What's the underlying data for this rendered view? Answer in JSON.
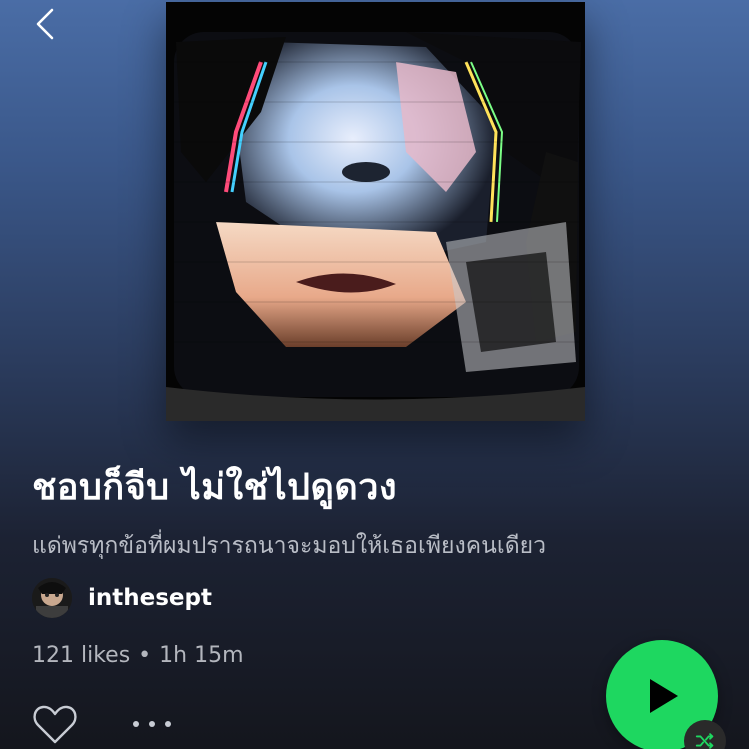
{
  "nav": {
    "back_icon": "chevron-left-icon"
  },
  "playlist": {
    "title": "ชอบก็จีบ ไม่ใช่ไปดูดวง",
    "description": "แด่พรทุกข้อที่ผมปรารถนาจะมอบให้เธอเพียงคนเดียว",
    "owner": "inthesept",
    "likes": "121 likes",
    "separator": "•",
    "duration": "1h 15m"
  },
  "actions": {
    "like_icon": "heart-outline-icon",
    "more_icon": "more-horizontal-icon",
    "play_icon": "play-icon",
    "shuffle_icon": "shuffle-icon"
  },
  "colors": {
    "accent": "#1ed760",
    "background_top": "#4a6da6",
    "background_bottom": "#14161d"
  }
}
